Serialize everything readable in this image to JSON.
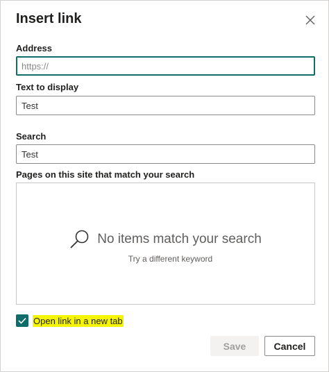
{
  "dialog": {
    "title": "Insert link",
    "close_icon": "close-icon"
  },
  "address": {
    "label": "Address",
    "value": "",
    "placeholder": "https://"
  },
  "display_text": {
    "label": "Text to display",
    "value": "Test"
  },
  "search": {
    "label": "Search",
    "value": "Test"
  },
  "results": {
    "label": "Pages on this site that match your search",
    "empty_title": "No items match your search",
    "empty_subtitle": "Try a different keyword",
    "empty_icon": "search-icon"
  },
  "new_tab": {
    "label": "Open link in a new tab",
    "checked": true,
    "highlight_color": "#f5f500"
  },
  "actions": {
    "save_label": "Save",
    "cancel_label": "Cancel"
  },
  "colors": {
    "accent": "#0e6d6b"
  }
}
